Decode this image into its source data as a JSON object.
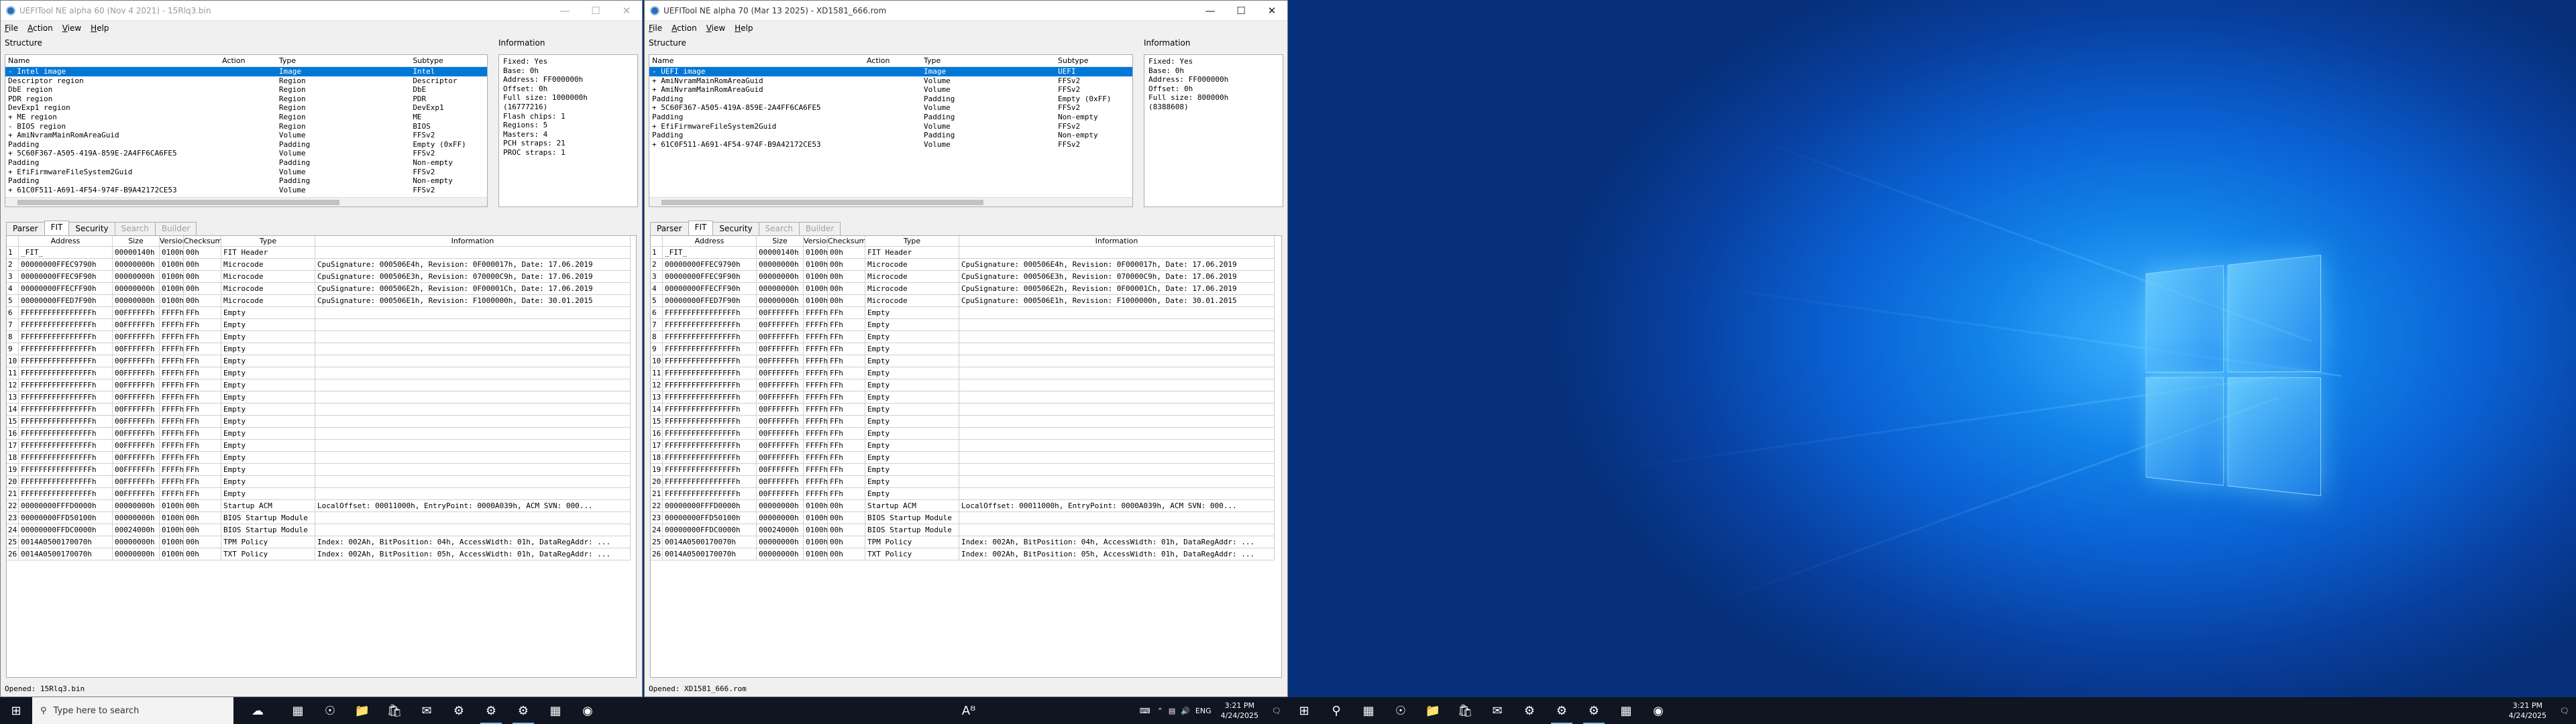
{
  "menu": [
    "File",
    "Action",
    "View",
    "Help"
  ],
  "windows": [
    {
      "title": "UEFITool NE alpha 60 (Nov 4 2021) - 15Rlq3.bin",
      "structure_label": "Structure",
      "information_label": "Information",
      "tree_headers": [
        "Name",
        "Action",
        "Type",
        "Subtype"
      ],
      "tree": [
        {
          "name": "- Intel image",
          "action": "",
          "type": "Image",
          "subtype": "Intel",
          "sel": true
        },
        {
          "name": "   Descriptor region",
          "action": "",
          "type": "Region",
          "subtype": "Descriptor"
        },
        {
          "name": "   DbE region",
          "action": "",
          "type": "Region",
          "subtype": "DbE"
        },
        {
          "name": "   PDR region",
          "action": "",
          "type": "Region",
          "subtype": "PDR"
        },
        {
          "name": "   DevExp1 region",
          "action": "",
          "type": "Region",
          "subtype": "DevExp1"
        },
        {
          "name": " + ME region",
          "action": "",
          "type": "Region",
          "subtype": "ME"
        },
        {
          "name": " - BIOS region",
          "action": "",
          "type": "Region",
          "subtype": "BIOS"
        },
        {
          "name": "   + AmiNvramMainRomAreaGuid",
          "action": "",
          "type": "Volume",
          "subtype": "FFSv2"
        },
        {
          "name": "     Padding",
          "action": "",
          "type": "Padding",
          "subtype": "Empty (0xFF)"
        },
        {
          "name": "   + 5C60F367-A505-419A-859E-2A4FF6CA6FE5",
          "action": "",
          "type": "Volume",
          "subtype": "FFSv2"
        },
        {
          "name": "     Padding",
          "action": "",
          "type": "Padding",
          "subtype": "Non-empty"
        },
        {
          "name": "   + EfiFirmwareFileSystem2Guid",
          "action": "",
          "type": "Volume",
          "subtype": "FFSv2"
        },
        {
          "name": "     Padding",
          "action": "",
          "type": "Padding",
          "subtype": "Non-empty"
        },
        {
          "name": "   + 61C0F511-A691-4F54-974F-B9A42172CE53",
          "action": "",
          "type": "Volume",
          "subtype": "FFSv2"
        }
      ],
      "info": "Fixed: Yes\nBase: 0h\nAddress: FF000000h\nOffset: 0h\nFull size: 1000000h\n(16777216)\nFlash chips: 1\nRegions: 5\nMasters: 4\nPCH straps: 21\nPROC straps: 1",
      "tabs": [
        {
          "label": "Parser",
          "state": ""
        },
        {
          "label": "FIT",
          "state": "active"
        },
        {
          "label": "Security",
          "state": ""
        },
        {
          "label": "Search",
          "state": "disabled"
        },
        {
          "label": "Builder",
          "state": "disabled"
        }
      ],
      "fit_headers": [
        "Address",
        "Size",
        "Version",
        "Checksum",
        "Type",
        "Information"
      ],
      "fit_rows": [
        [
          "_FIT_",
          "00000140h",
          "0100h",
          "00h",
          "FIT Header",
          ""
        ],
        [
          "00000000FFEC9790h",
          "00000000h",
          "0100h",
          "00h",
          "Microcode",
          "CpuSignature: 000506E4h, Revision: 0F000017h, Date: 17.06.2019"
        ],
        [
          "00000000FFEC9F90h",
          "00000000h",
          "0100h",
          "00h",
          "Microcode",
          "CpuSignature: 000506E3h, Revision: 070000C9h, Date: 17.06.2019"
        ],
        [
          "00000000FFECFF90h",
          "00000000h",
          "0100h",
          "00h",
          "Microcode",
          "CpuSignature: 000506E2h, Revision: 0F00001Ch, Date: 17.06.2019"
        ],
        [
          "00000000FFED7F90h",
          "00000000h",
          "0100h",
          "00h",
          "Microcode",
          "CpuSignature: 000506E1h, Revision: F1000000h, Date: 30.01.2015"
        ],
        [
          "FFFFFFFFFFFFFFFFh",
          "00FFFFFFh",
          "FFFFh",
          "FFh",
          "Empty",
          ""
        ],
        [
          "FFFFFFFFFFFFFFFFh",
          "00FFFFFFh",
          "FFFFh",
          "FFh",
          "Empty",
          ""
        ],
        [
          "FFFFFFFFFFFFFFFFh",
          "00FFFFFFh",
          "FFFFh",
          "FFh",
          "Empty",
          ""
        ],
        [
          "FFFFFFFFFFFFFFFFh",
          "00FFFFFFh",
          "FFFFh",
          "FFh",
          "Empty",
          ""
        ],
        [
          "FFFFFFFFFFFFFFFFh",
          "00FFFFFFh",
          "FFFFh",
          "FFh",
          "Empty",
          ""
        ],
        [
          "FFFFFFFFFFFFFFFFh",
          "00FFFFFFh",
          "FFFFh",
          "FFh",
          "Empty",
          ""
        ],
        [
          "FFFFFFFFFFFFFFFFh",
          "00FFFFFFh",
          "FFFFh",
          "FFh",
          "Empty",
          ""
        ],
        [
          "FFFFFFFFFFFFFFFFh",
          "00FFFFFFh",
          "FFFFh",
          "FFh",
          "Empty",
          ""
        ],
        [
          "FFFFFFFFFFFFFFFFh",
          "00FFFFFFh",
          "FFFFh",
          "FFh",
          "Empty",
          ""
        ],
        [
          "FFFFFFFFFFFFFFFFh",
          "00FFFFFFh",
          "FFFFh",
          "FFh",
          "Empty",
          ""
        ],
        [
          "FFFFFFFFFFFFFFFFh",
          "00FFFFFFh",
          "FFFFh",
          "FFh",
          "Empty",
          ""
        ],
        [
          "FFFFFFFFFFFFFFFFh",
          "00FFFFFFh",
          "FFFFh",
          "FFh",
          "Empty",
          ""
        ],
        [
          "FFFFFFFFFFFFFFFFh",
          "00FFFFFFh",
          "FFFFh",
          "FFh",
          "Empty",
          ""
        ],
        [
          "FFFFFFFFFFFFFFFFh",
          "00FFFFFFh",
          "FFFFh",
          "FFh",
          "Empty",
          ""
        ],
        [
          "FFFFFFFFFFFFFFFFh",
          "00FFFFFFh",
          "FFFFh",
          "FFh",
          "Empty",
          ""
        ],
        [
          "FFFFFFFFFFFFFFFFh",
          "00FFFFFFh",
          "FFFFh",
          "FFh",
          "Empty",
          ""
        ],
        [
          "00000000FFFD0000h",
          "00000000h",
          "0100h",
          "00h",
          "Startup ACM",
          "LocalOffset: 00011000h, EntryPoint: 0000A039h, ACM SVN: 000..."
        ],
        [
          "00000000FFD50100h",
          "00000000h",
          "0100h",
          "00h",
          "BIOS Startup Module",
          ""
        ],
        [
          "00000000FFDC0000h",
          "00024000h",
          "0100h",
          "00h",
          "BIOS Startup Module",
          ""
        ],
        [
          "0014A0500170070h",
          "00000000h",
          "0100h",
          "00h",
          "TPM Policy",
          "Index: 002Ah, BitPosition: 04h, AccessWidth: 01h, DataRegAddr: ..."
        ],
        [
          "0014A0500170070h",
          "00000000h",
          "0100h",
          "00h",
          "TXT Policy",
          "Index: 002Ah, BitPosition: 05h, AccessWidth: 01h, DataRegAddr: ..."
        ]
      ],
      "status": "Opened: 15Rlq3.bin"
    },
    {
      "title": "UEFITool NE alpha 70 (Mar 13 2025) - XD1581_666.rom",
      "structure_label": "Structure",
      "information_label": "Information",
      "tree_headers": [
        "Name",
        "Action",
        "Type",
        "Subtype"
      ],
      "tree": [
        {
          "name": "- UEFI image",
          "action": "",
          "type": "Image",
          "subtype": "UEFI",
          "sel": true
        },
        {
          "name": " + AmiNvramMainRomAreaGuid",
          "action": "",
          "type": "Volume",
          "subtype": "FFSv2"
        },
        {
          "name": " + AmiNvramMainRomAreaGuid",
          "action": "",
          "type": "Volume",
          "subtype": "FFSv2"
        },
        {
          "name": "   Padding",
          "action": "",
          "type": "Padding",
          "subtype": "Empty (0xFF)"
        },
        {
          "name": " + 5C60F367-A505-419A-859E-2A4FF6CA6FE5",
          "action": "",
          "type": "Volume",
          "subtype": "FFSv2"
        },
        {
          "name": "   Padding",
          "action": "",
          "type": "Padding",
          "subtype": "Non-empty"
        },
        {
          "name": " + EfiFirmwareFileSystem2Guid",
          "action": "",
          "type": "Volume",
          "subtype": "FFSv2"
        },
        {
          "name": "   Padding",
          "action": "",
          "type": "Padding",
          "subtype": "Non-empty"
        },
        {
          "name": " + 61C0F511-A691-4F54-974F-B9A42172CE53",
          "action": "",
          "type": "Volume",
          "subtype": "FFSv2"
        }
      ],
      "info": "Fixed: Yes\nBase: 0h\nAddress: FF000000h\nOffset: 0h\nFull size: 800000h\n(8388608)",
      "tabs": [
        {
          "label": "Parser",
          "state": ""
        },
        {
          "label": "FIT",
          "state": "active"
        },
        {
          "label": "Security",
          "state": ""
        },
        {
          "label": "Search",
          "state": "disabled"
        },
        {
          "label": "Builder",
          "state": "disabled"
        }
      ],
      "fit_headers": [
        "Address",
        "Size",
        "Version",
        "Checksum",
        "Type",
        "Information"
      ],
      "fit_rows": [
        [
          "_FIT_",
          "00000140h",
          "0100h",
          "00h",
          "FIT Header",
          ""
        ],
        [
          "00000000FFEC9790h",
          "00000000h",
          "0100h",
          "00h",
          "Microcode",
          "CpuSignature: 000506E4h, Revision: 0F000017h, Date: 17.06.2019"
        ],
        [
          "00000000FFEC9F90h",
          "00000000h",
          "0100h",
          "00h",
          "Microcode",
          "CpuSignature: 000506E3h, Revision: 070000C9h, Date: 17.06.2019"
        ],
        [
          "00000000FFECFF90h",
          "00000000h",
          "0100h",
          "00h",
          "Microcode",
          "CpuSignature: 000506E2h, Revision: 0F00001Ch, Date: 17.06.2019"
        ],
        [
          "00000000FFED7F90h",
          "00000000h",
          "0100h",
          "00h",
          "Microcode",
          "CpuSignature: 000506E1h, Revision: F1000000h, Date: 30.01.2015"
        ],
        [
          "FFFFFFFFFFFFFFFFh",
          "00FFFFFFh",
          "FFFFh",
          "FFh",
          "Empty",
          ""
        ],
        [
          "FFFFFFFFFFFFFFFFh",
          "00FFFFFFh",
          "FFFFh",
          "FFh",
          "Empty",
          ""
        ],
        [
          "FFFFFFFFFFFFFFFFh",
          "00FFFFFFh",
          "FFFFh",
          "FFh",
          "Empty",
          ""
        ],
        [
          "FFFFFFFFFFFFFFFFh",
          "00FFFFFFh",
          "FFFFh",
          "FFh",
          "Empty",
          ""
        ],
        [
          "FFFFFFFFFFFFFFFFh",
          "00FFFFFFh",
          "FFFFh",
          "FFh",
          "Empty",
          ""
        ],
        [
          "FFFFFFFFFFFFFFFFh",
          "00FFFFFFh",
          "FFFFh",
          "FFh",
          "Empty",
          ""
        ],
        [
          "FFFFFFFFFFFFFFFFh",
          "00FFFFFFh",
          "FFFFh",
          "FFh",
          "Empty",
          ""
        ],
        [
          "FFFFFFFFFFFFFFFFh",
          "00FFFFFFh",
          "FFFFh",
          "FFh",
          "Empty",
          ""
        ],
        [
          "FFFFFFFFFFFFFFFFh",
          "00FFFFFFh",
          "FFFFh",
          "FFh",
          "Empty",
          ""
        ],
        [
          "FFFFFFFFFFFFFFFFh",
          "00FFFFFFh",
          "FFFFh",
          "FFh",
          "Empty",
          ""
        ],
        [
          "FFFFFFFFFFFFFFFFh",
          "00FFFFFFh",
          "FFFFh",
          "FFh",
          "Empty",
          ""
        ],
        [
          "FFFFFFFFFFFFFFFFh",
          "00FFFFFFh",
          "FFFFh",
          "FFh",
          "Empty",
          ""
        ],
        [
          "FFFFFFFFFFFFFFFFh",
          "00FFFFFFh",
          "FFFFh",
          "FFh",
          "Empty",
          ""
        ],
        [
          "FFFFFFFFFFFFFFFFh",
          "00FFFFFFh",
          "FFFFh",
          "FFh",
          "Empty",
          ""
        ],
        [
          "FFFFFFFFFFFFFFFFh",
          "00FFFFFFh",
          "FFFFh",
          "FFh",
          "Empty",
          ""
        ],
        [
          "FFFFFFFFFFFFFFFFh",
          "00FFFFFFh",
          "FFFFh",
          "FFh",
          "Empty",
          ""
        ],
        [
          "00000000FFFD0000h",
          "00000000h",
          "0100h",
          "00h",
          "Startup ACM",
          "LocalOffset: 00011000h, EntryPoint: 0000A039h, ACM SVN: 000..."
        ],
        [
          "00000000FFD50100h",
          "00000000h",
          "0100h",
          "00h",
          "BIOS Startup Module",
          ""
        ],
        [
          "00000000FFDC0000h",
          "00024000h",
          "0100h",
          "00h",
          "BIOS Startup Module",
          ""
        ],
        [
          "0014A0500170070h",
          "00000000h",
          "0100h",
          "00h",
          "TPM Policy",
          "Index: 002Ah, BitPosition: 04h, AccessWidth: 01h, DataRegAddr: ..."
        ],
        [
          "0014A0500170070h",
          "00000000h",
          "0100h",
          "00h",
          "TXT Policy",
          "Index: 002Ah, BitPosition: 05h, AccessWidth: 01h, DataRegAddr: ..."
        ]
      ],
      "status": "Opened: XD1581_666.rom"
    }
  ],
  "taskbar": {
    "search_placeholder": "Type here to search",
    "time": "3:21 PM",
    "date": "4/24/2025",
    "time2": "3:21 PM",
    "date2": "4/24/2025"
  }
}
